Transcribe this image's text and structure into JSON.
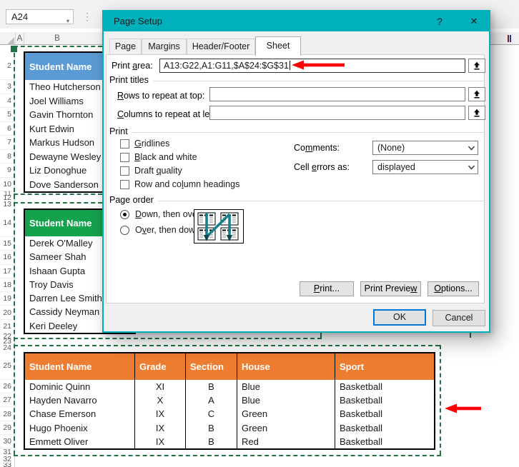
{
  "colors": {
    "dialog_titlebar": "#00B1BC",
    "marquee_green": "#217346",
    "annotation_arrow_red": "#FB0207",
    "table1_header_blue": "#5B9BD5",
    "table2_header_green": "#15A24C",
    "table3_header_orange": "#ED7D31",
    "ok_focus_blue": "#0078D7"
  },
  "excel": {
    "name_box": "A24",
    "icons": {
      "name_box_dropdown": "▾",
      "formula_divider": "⋮"
    },
    "column_headers": {
      "a": "A",
      "b": "B"
    },
    "row_numbers": [
      "",
      "2",
      "3",
      "4",
      "5",
      "6",
      "7",
      "8",
      "9",
      "10",
      "11",
      "12",
      "13",
      "14",
      "15",
      "16",
      "17",
      "18",
      "19",
      "20",
      "21",
      "22",
      "23",
      "24",
      "25",
      "26",
      "27",
      "28",
      "29",
      "30",
      "31",
      "32",
      "33"
    ],
    "table1": {
      "header": "Student Name",
      "rows": [
        "Theo Hutcherson",
        "Joel Williams",
        "Gavin Thornton",
        "Kurt Edwin",
        "Markus Hudson",
        "Dewayne Wesley",
        "Liz Donoghue",
        "Dove Sanderson"
      ]
    },
    "table2": {
      "header": "Student Name",
      "rows": [
        "Derek O'Malley",
        "Sameer Shah",
        "Ishaan Gupta",
        "Troy Davis",
        "Darren Lee Smith",
        "Cassidy Neyman",
        "Keri Deeley"
      ]
    },
    "table3": {
      "headers": [
        "Student Name",
        "Grade",
        "Section",
        "House",
        "Sport"
      ],
      "rows": [
        [
          "Dominic Quinn",
          "XI",
          "B",
          "Blue",
          "Basketball"
        ],
        [
          "Hayden Navarro",
          "X",
          "A",
          "Blue",
          "Basketball"
        ],
        [
          "Chase Emerson",
          "IX",
          "C",
          "Green",
          "Basketball"
        ],
        [
          "Hugo Phoenix",
          "IX",
          "B",
          "Green",
          "Basketball"
        ],
        [
          "Emmett Oliver",
          "IX",
          "B",
          "Red",
          "Basketball"
        ]
      ]
    }
  },
  "dialog": {
    "title": "Page Setup",
    "icons": {
      "help": "?",
      "close": "✕"
    },
    "tabs": [
      "Page",
      "Margins",
      "Header/Footer",
      "Sheet"
    ],
    "active_tab": "Sheet",
    "print_area": {
      "label": {
        "t": "Print area:",
        "u": 6
      },
      "value": "A13:G22,A1:G11,$A$24:$G$31"
    },
    "print_titles": {
      "group_label": "Print titles",
      "rows_label": {
        "t": "Rows to repeat at top:",
        "u": 0
      },
      "rows_value": "",
      "cols_label": {
        "t": "Columns to repeat at left:",
        "u": 0
      },
      "cols_value": ""
    },
    "print": {
      "group_label": "Print",
      "checkboxes": [
        {
          "t": "Gridlines",
          "u": 0
        },
        {
          "t": "Black and white",
          "u": 0
        },
        {
          "t": "Draft quality",
          "u": 6
        },
        {
          "t": "Row and column headings",
          "u": 10
        }
      ],
      "comments_label": {
        "t": "Comments:",
        "u": 2
      },
      "comments_value": "(None)",
      "cell_errors_label": {
        "t": "Cell errors as:",
        "u": 5
      },
      "cell_errors_value": "displayed"
    },
    "page_order": {
      "group_label": "Page order",
      "option1": {
        "t": "Down, then over",
        "u": 0
      },
      "option2": {
        "t": "Over, then down",
        "u": 1
      },
      "selected": "Down, then over"
    },
    "buttons": {
      "print": {
        "t": "Print...",
        "u": 0
      },
      "print_preview": {
        "t": "Print Preview",
        "u": 12
      },
      "options": {
        "t": "Options...",
        "u": 0
      },
      "ok": "OK",
      "cancel": "Cancel"
    }
  }
}
